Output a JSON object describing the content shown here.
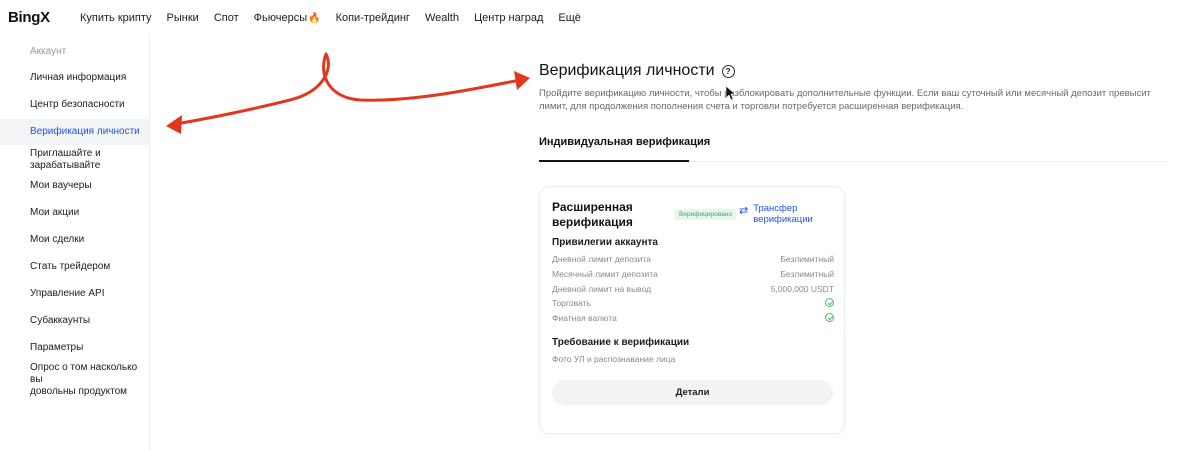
{
  "brand": {
    "logo": "BingX"
  },
  "nav": {
    "items": [
      "Купить крипту",
      "Рынки",
      "Спот",
      "Фьючерсы",
      "Копи-трейдинг",
      "Wealth",
      "Центр наград",
      "Ещё"
    ]
  },
  "sidebar": {
    "header": "Аккаунт",
    "items": [
      {
        "label": "Личная информация"
      },
      {
        "label": "Центр безопасности"
      },
      {
        "label": "Верификация личности",
        "active": true
      },
      {
        "label": "Приглашайте и\nзарабатывайте"
      },
      {
        "label": "Мои ваучеры"
      },
      {
        "label": "Мои акции"
      },
      {
        "label": "Мои сделки"
      },
      {
        "label": "Стать трейдером"
      },
      {
        "label": "Управление API"
      },
      {
        "label": "Субаккаунты"
      },
      {
        "label": "Параметры"
      },
      {
        "label": "Опрос о том насколько вы\nдовольны продуктом"
      }
    ]
  },
  "main": {
    "title": "Верификация личности",
    "help_icon": "?",
    "description": "Пройдите верификацию личности, чтобы разблокировать дополнительные функции. Если ваш суточный или месячный депозит превысит лимит, для продолжения пополнения счета и торговли потребуется расширенная верификация.",
    "tab": "Индивидуальная верификация"
  },
  "card": {
    "title": "Расширенная верификация",
    "badge": "Верифицировано",
    "transfer_label": "Трансфер верификации",
    "transfer_icon": "⇄",
    "privileges_title": "Привилегии аккаунта",
    "privileges": [
      {
        "label": "Дневной лимит депозита",
        "value": "Безлимитный"
      },
      {
        "label": "Месячный лимит депозита",
        "value": "Безлимитный"
      },
      {
        "label": "Дневной лимит на вывод",
        "value": "5,000,000 USDT"
      },
      {
        "label": "Торговать",
        "check": true
      },
      {
        "label": "Фиатная валюта",
        "check": true
      }
    ],
    "requirement_title": "Требование к верификации",
    "requirement_text": "Фото УЛ и распознавание лица",
    "details_button": "Детали"
  },
  "colors": {
    "accent": "#2354e6",
    "annotation_arrow": "#e0371e",
    "verified_green": "#4cb874"
  }
}
